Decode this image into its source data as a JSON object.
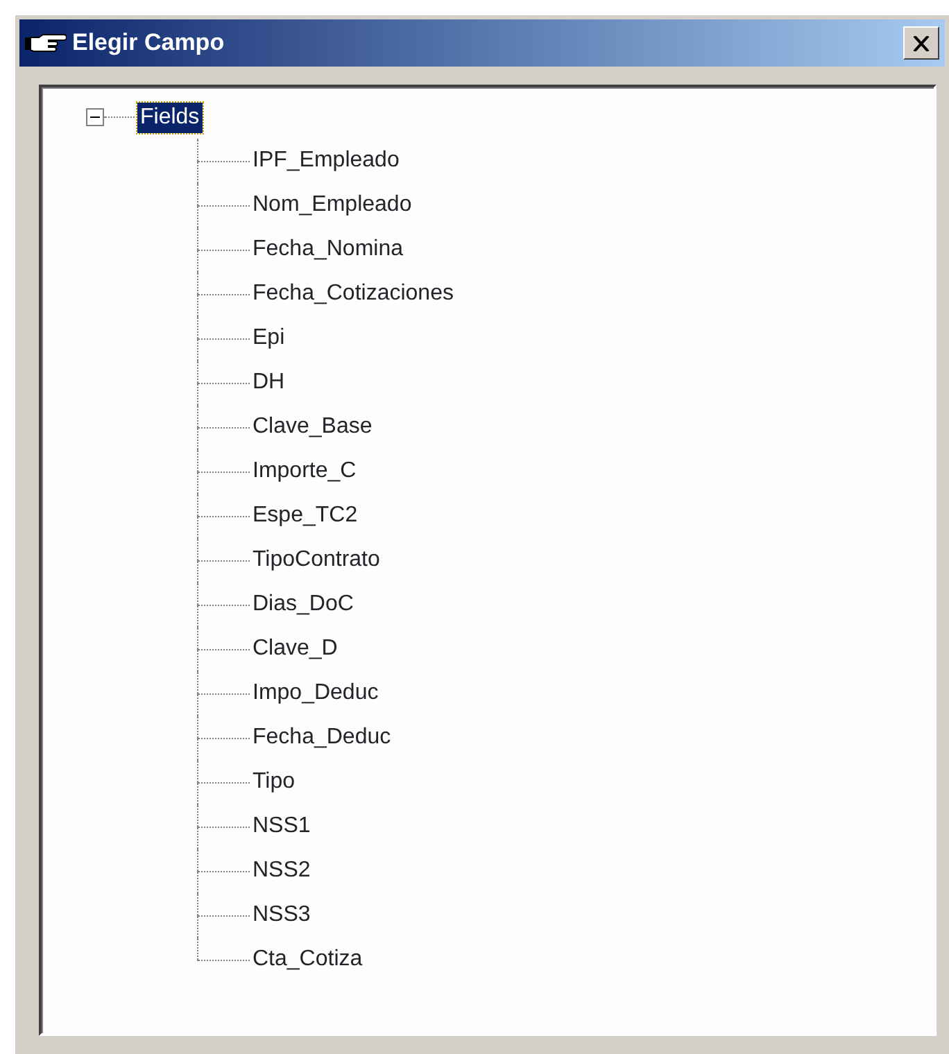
{
  "window": {
    "title": "Elegir Campo"
  },
  "tree": [
    {
      "label": "Fields",
      "selected": true,
      "expanded": true,
      "children": [
        {
          "label": "IPF_Empleado",
          "selected": false
        },
        {
          "label": "Nom_Empleado",
          "selected": false
        },
        {
          "label": "Fecha_Nomina",
          "selected": false
        },
        {
          "label": "Fecha_Cotizaciones",
          "selected": false
        },
        {
          "label": "Epi",
          "selected": false
        },
        {
          "label": "DH",
          "selected": false
        },
        {
          "label": "Clave_Base",
          "selected": false
        },
        {
          "label": "Importe_C",
          "selected": false
        },
        {
          "label": "Espe_TC2",
          "selected": false
        },
        {
          "label": "TipoContrato",
          "selected": false
        },
        {
          "label": "Dias_DoC",
          "selected": false
        },
        {
          "label": "Clave_D",
          "selected": false
        },
        {
          "label": "Impo_Deduc",
          "selected": false
        },
        {
          "label": "Fecha_Deduc",
          "selected": false
        },
        {
          "label": "Tipo",
          "selected": false
        },
        {
          "label": "NSS1",
          "selected": false
        },
        {
          "label": "NSS2",
          "selected": false
        },
        {
          "label": "NSS3",
          "selected": false
        },
        {
          "label": "Cta_Cotiza",
          "selected": false
        }
      ]
    }
  ]
}
